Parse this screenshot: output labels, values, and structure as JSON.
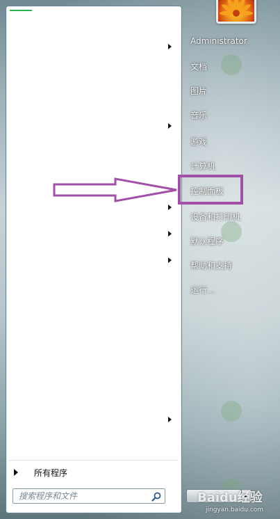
{
  "start_menu": {
    "user_avatar_icon": "flower-avatar-icon",
    "right_column": {
      "items": [
        {
          "label": "Administrator"
        },
        {
          "label": "文档"
        },
        {
          "label": "图片"
        },
        {
          "label": "音乐"
        },
        {
          "label": "游戏"
        },
        {
          "label": "计算机"
        },
        {
          "label": "控制面板"
        },
        {
          "label": "设备和打印机"
        },
        {
          "label": "默认程序"
        },
        {
          "label": "帮助和支持"
        },
        {
          "label": "运行..."
        }
      ]
    },
    "left_column": {
      "all_programs_label": "所有程序",
      "search_placeholder": "搜索程序和文件"
    },
    "annotation": {
      "highlighted_item": "控制面板",
      "highlight_color": "#a24fa8",
      "arrow_color": "#a24fa8"
    }
  },
  "watermark": {
    "text": "Baidu经验",
    "url": "jingyan.baidu.com"
  }
}
